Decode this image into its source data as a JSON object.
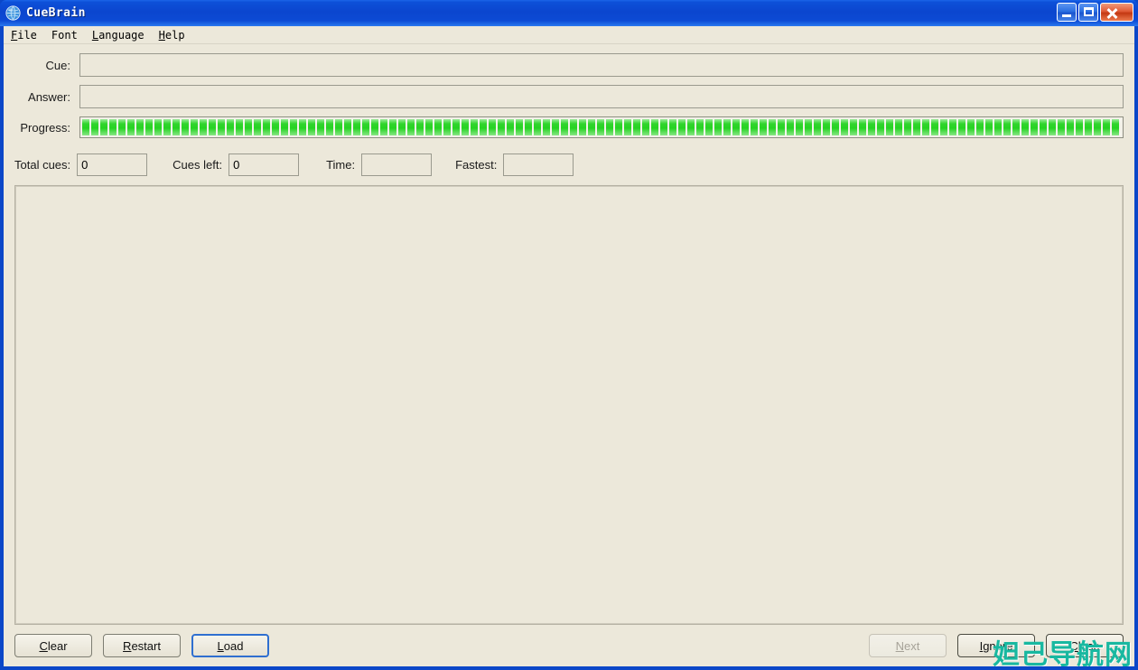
{
  "window": {
    "title": "CueBrain",
    "icon": "globe-icon",
    "controls": {
      "minimize": "Minimize",
      "maximize": "Maximize",
      "close": "Close"
    }
  },
  "menubar": {
    "items": [
      {
        "label": "File",
        "mnemonic": "F"
      },
      {
        "label": "Font",
        "mnemonic": ""
      },
      {
        "label": "Language",
        "mnemonic": "L"
      },
      {
        "label": "Help",
        "mnemonic": "H"
      }
    ]
  },
  "form": {
    "cue": {
      "label": "Cue:",
      "value": "",
      "placeholder": ""
    },
    "answer": {
      "label": "Answer:",
      "value": "",
      "placeholder": ""
    },
    "progress": {
      "label": "Progress:",
      "percent": 100
    }
  },
  "stats": {
    "total_cues": {
      "label": "Total cues:",
      "value": "0"
    },
    "cues_left": {
      "label": "Cues left:",
      "value": "0"
    },
    "time": {
      "label": "Time:",
      "value": ""
    },
    "fastest": {
      "label": "Fastest:",
      "value": ""
    }
  },
  "content": {
    "text": ""
  },
  "buttons": {
    "left": [
      {
        "label": "Clear",
        "mnemonic": "C",
        "state": "normal"
      },
      {
        "label": "Restart",
        "mnemonic": "R",
        "state": "normal"
      },
      {
        "label": "Load",
        "mnemonic": "L",
        "state": "focused"
      }
    ],
    "right": [
      {
        "label": "Next",
        "mnemonic": "N",
        "state": "disabled"
      },
      {
        "label": "Ignore",
        "mnemonic": "I",
        "state": "strong"
      },
      {
        "label": "Close",
        "mnemonic": "C",
        "state": "strong"
      }
    ]
  },
  "watermark": {
    "text": "妲己导航网",
    "color": "#18b8a0"
  },
  "colors": {
    "window_background": "#ece8da",
    "titlebar_blue": "#0b46cf",
    "progress_green": "#26d322",
    "field_border": "#9a9a8e"
  }
}
